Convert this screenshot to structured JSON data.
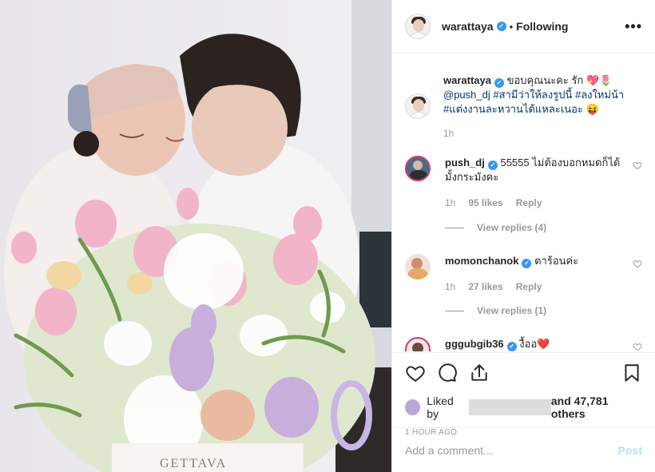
{
  "post": {
    "author": "warattaya",
    "following_label": "Following",
    "more_label": "•••",
    "photo_brand": "GETTAVA"
  },
  "caption": {
    "username": "warattaya",
    "text_line1": "ขอบคุณนะคะ รัก 💖🌷",
    "mention": "@push_dj",
    "tags_line2": "#สามีว่าให้ลงรูปนี้ #ลงใหม่น้า",
    "tags_line3": "#แต่งงานละหวานได้แหละเนอะ 😝",
    "time": "1h"
  },
  "comments": [
    {
      "username": "push_dj",
      "text": "55555 ไม่ต้องบอกหมดก็ได้มั้งกระมังคะ",
      "time": "1h",
      "likes": "95 likes",
      "reply_label": "Reply",
      "view_replies": "View replies (4)"
    },
    {
      "username": "momonchanok",
      "text": "ตาร้อนค่ะ",
      "time": "1h",
      "likes": "27 likes",
      "reply_label": "Reply",
      "view_replies": "View replies (1)"
    },
    {
      "username": "gggubgib36",
      "text": "งื้ออ❤️"
    }
  ],
  "likes": {
    "prefix": "Liked by",
    "suffix": "and 47,781 others",
    "time_ago": "1 HOUR AGO"
  },
  "add_comment": {
    "placeholder": "Add a comment...",
    "post_label": "Post"
  },
  "colors": {
    "verified": "#3897f0",
    "tag": "#003569",
    "post_disabled": "#b2dffc"
  }
}
